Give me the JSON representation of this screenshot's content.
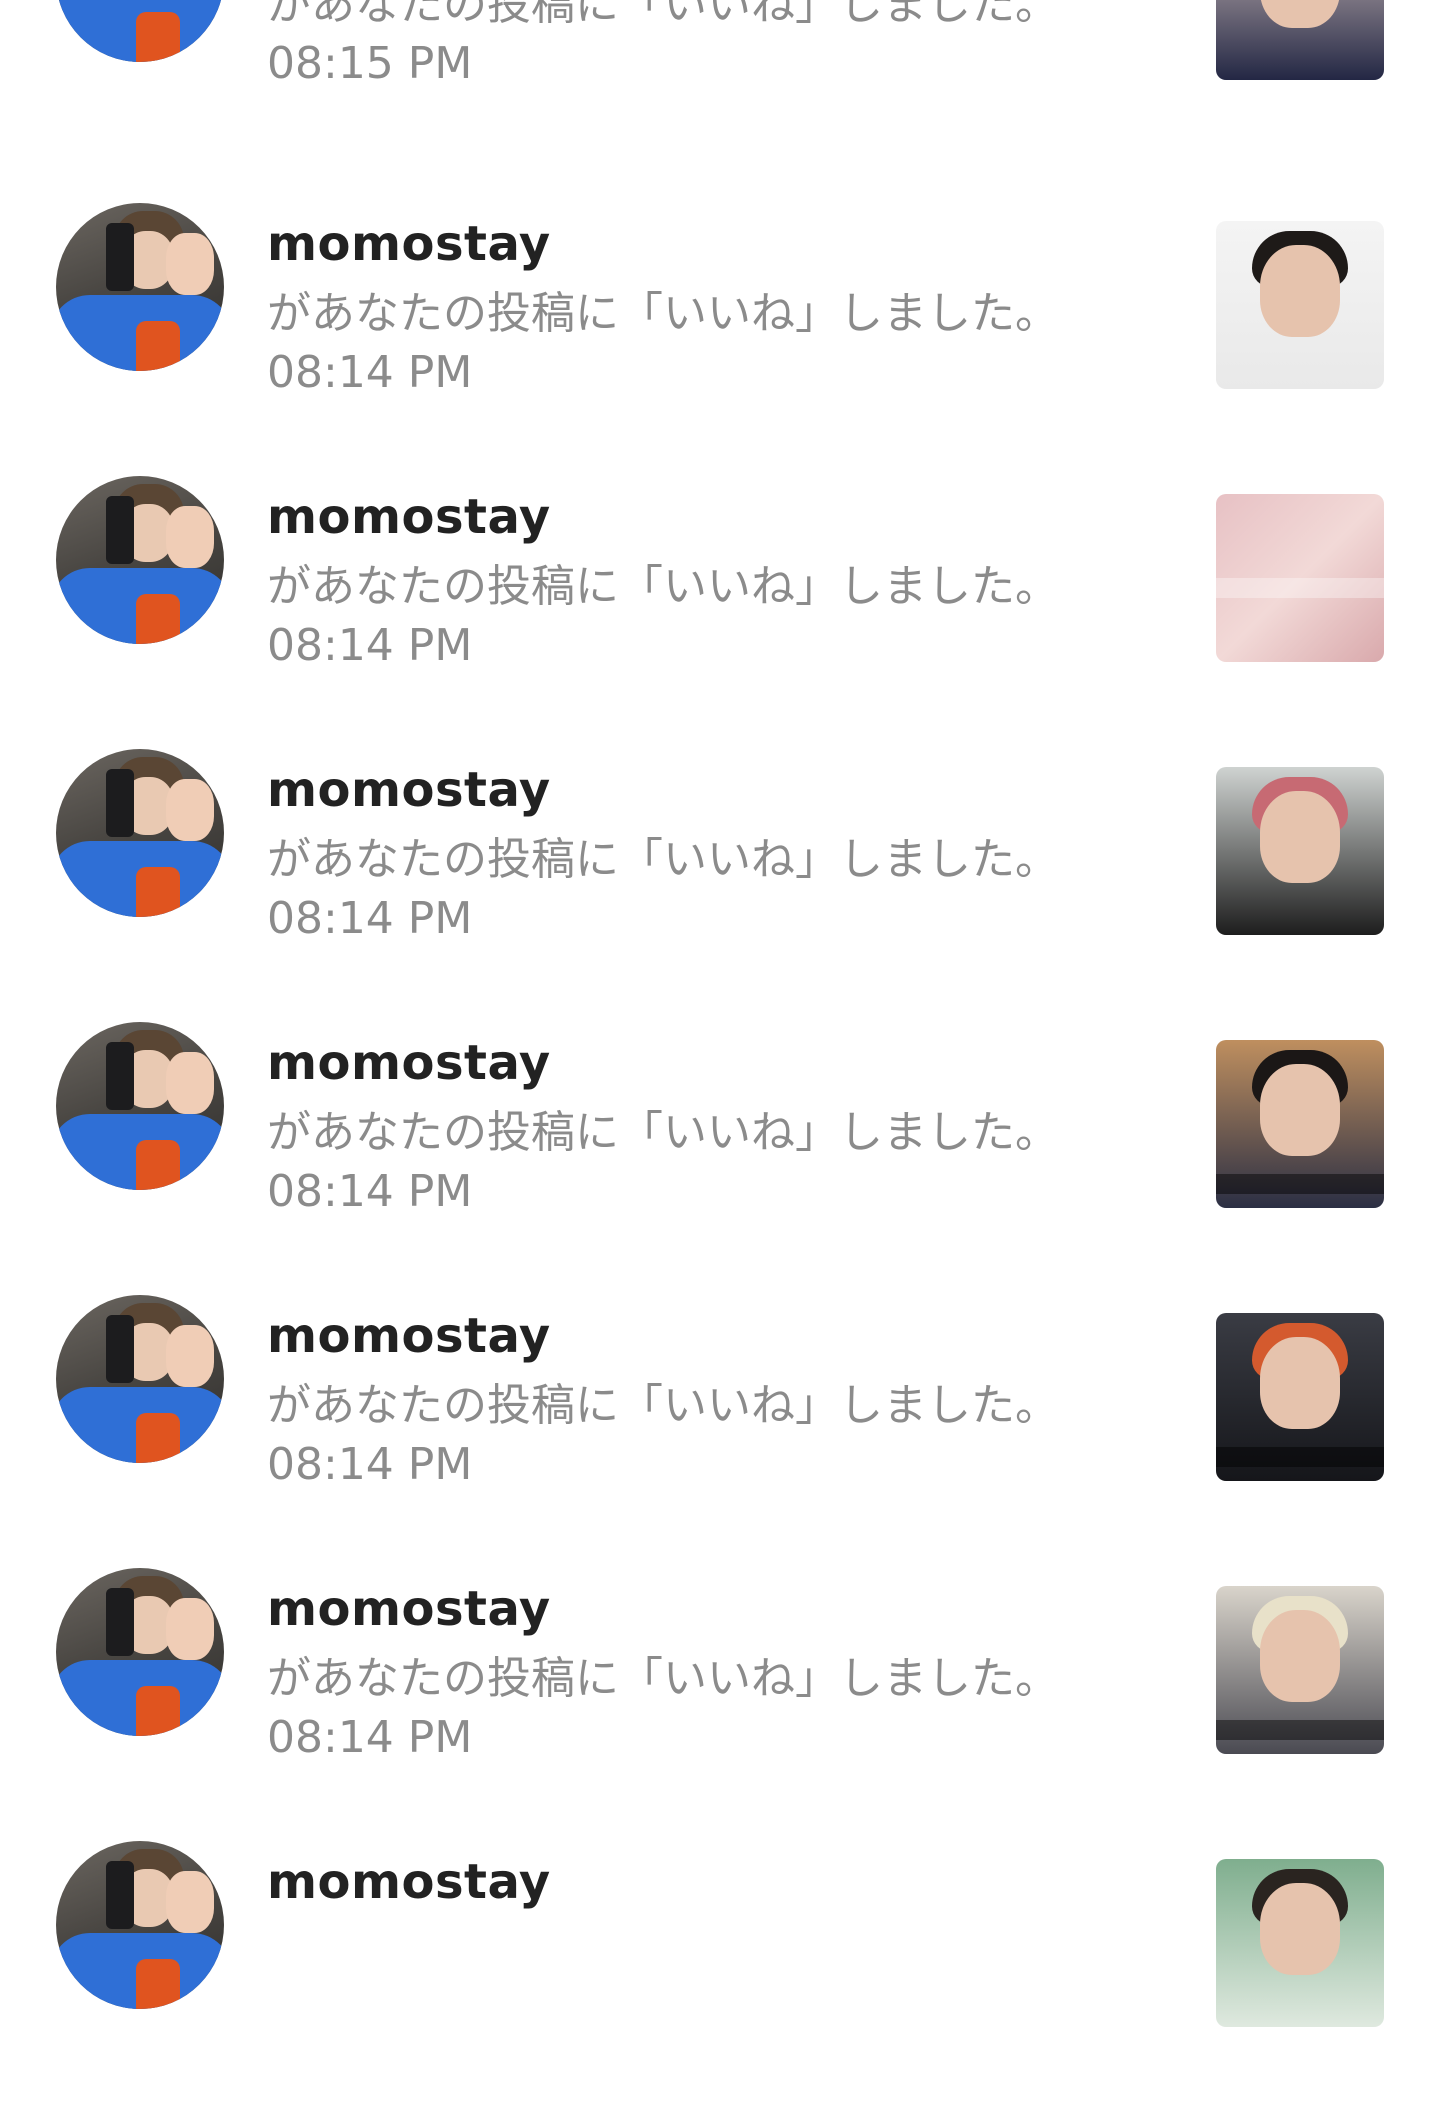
{
  "notifications": [
    {
      "username": "",
      "message": "があなたの投稿に「いいね」しました。",
      "time": "08:15 PM"
    },
    {
      "username": "momostay",
      "message": "があなたの投稿に「いいね」しました。",
      "time": "08:14 PM"
    },
    {
      "username": "momostay",
      "message": "があなたの投稿に「いいね」しました。",
      "time": "08:14 PM"
    },
    {
      "username": "momostay",
      "message": "があなたの投稿に「いいね」しました。",
      "time": "08:14 PM"
    },
    {
      "username": "momostay",
      "message": "があなたの投稿に「いいね」しました。",
      "time": "08:14 PM"
    },
    {
      "username": "momostay",
      "message": "があなたの投稿に「いいね」しました。",
      "time": "08:14 PM"
    },
    {
      "username": "momostay",
      "message": "があなたの投稿に「いいね」しました。",
      "time": "08:14 PM"
    },
    {
      "username": "momostay",
      "message": "",
      "time": ""
    }
  ],
  "colors": {
    "username": "#222222",
    "secondary_text": "#8b8b8b",
    "background": "#ffffff"
  }
}
